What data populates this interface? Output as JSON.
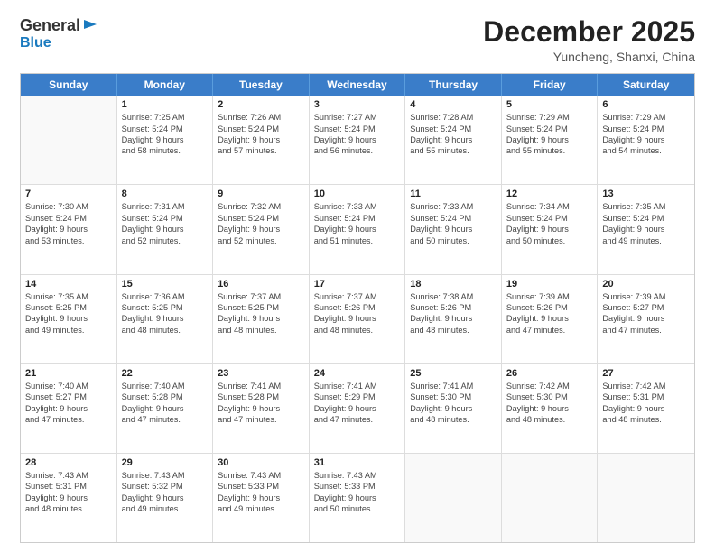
{
  "header": {
    "logo_general": "General",
    "logo_blue": "Blue",
    "month_title": "December 2025",
    "location": "Yuncheng, Shanxi, China"
  },
  "days_of_week": [
    "Sunday",
    "Monday",
    "Tuesday",
    "Wednesday",
    "Thursday",
    "Friday",
    "Saturday"
  ],
  "weeks": [
    [
      {
        "day": "",
        "empty": true,
        "lines": []
      },
      {
        "day": "1",
        "empty": false,
        "lines": [
          "Sunrise: 7:25 AM",
          "Sunset: 5:24 PM",
          "Daylight: 9 hours",
          "and 58 minutes."
        ]
      },
      {
        "day": "2",
        "empty": false,
        "lines": [
          "Sunrise: 7:26 AM",
          "Sunset: 5:24 PM",
          "Daylight: 9 hours",
          "and 57 minutes."
        ]
      },
      {
        "day": "3",
        "empty": false,
        "lines": [
          "Sunrise: 7:27 AM",
          "Sunset: 5:24 PM",
          "Daylight: 9 hours",
          "and 56 minutes."
        ]
      },
      {
        "day": "4",
        "empty": false,
        "lines": [
          "Sunrise: 7:28 AM",
          "Sunset: 5:24 PM",
          "Daylight: 9 hours",
          "and 55 minutes."
        ]
      },
      {
        "day": "5",
        "empty": false,
        "lines": [
          "Sunrise: 7:29 AM",
          "Sunset: 5:24 PM",
          "Daylight: 9 hours",
          "and 55 minutes."
        ]
      },
      {
        "day": "6",
        "empty": false,
        "lines": [
          "Sunrise: 7:29 AM",
          "Sunset: 5:24 PM",
          "Daylight: 9 hours",
          "and 54 minutes."
        ]
      }
    ],
    [
      {
        "day": "7",
        "empty": false,
        "lines": [
          "Sunrise: 7:30 AM",
          "Sunset: 5:24 PM",
          "Daylight: 9 hours",
          "and 53 minutes."
        ]
      },
      {
        "day": "8",
        "empty": false,
        "lines": [
          "Sunrise: 7:31 AM",
          "Sunset: 5:24 PM",
          "Daylight: 9 hours",
          "and 52 minutes."
        ]
      },
      {
        "day": "9",
        "empty": false,
        "lines": [
          "Sunrise: 7:32 AM",
          "Sunset: 5:24 PM",
          "Daylight: 9 hours",
          "and 52 minutes."
        ]
      },
      {
        "day": "10",
        "empty": false,
        "lines": [
          "Sunrise: 7:33 AM",
          "Sunset: 5:24 PM",
          "Daylight: 9 hours",
          "and 51 minutes."
        ]
      },
      {
        "day": "11",
        "empty": false,
        "lines": [
          "Sunrise: 7:33 AM",
          "Sunset: 5:24 PM",
          "Daylight: 9 hours",
          "and 50 minutes."
        ]
      },
      {
        "day": "12",
        "empty": false,
        "lines": [
          "Sunrise: 7:34 AM",
          "Sunset: 5:24 PM",
          "Daylight: 9 hours",
          "and 50 minutes."
        ]
      },
      {
        "day": "13",
        "empty": false,
        "lines": [
          "Sunrise: 7:35 AM",
          "Sunset: 5:24 PM",
          "Daylight: 9 hours",
          "and 49 minutes."
        ]
      }
    ],
    [
      {
        "day": "14",
        "empty": false,
        "lines": [
          "Sunrise: 7:35 AM",
          "Sunset: 5:25 PM",
          "Daylight: 9 hours",
          "and 49 minutes."
        ]
      },
      {
        "day": "15",
        "empty": false,
        "lines": [
          "Sunrise: 7:36 AM",
          "Sunset: 5:25 PM",
          "Daylight: 9 hours",
          "and 48 minutes."
        ]
      },
      {
        "day": "16",
        "empty": false,
        "lines": [
          "Sunrise: 7:37 AM",
          "Sunset: 5:25 PM",
          "Daylight: 9 hours",
          "and 48 minutes."
        ]
      },
      {
        "day": "17",
        "empty": false,
        "lines": [
          "Sunrise: 7:37 AM",
          "Sunset: 5:26 PM",
          "Daylight: 9 hours",
          "and 48 minutes."
        ]
      },
      {
        "day": "18",
        "empty": false,
        "lines": [
          "Sunrise: 7:38 AM",
          "Sunset: 5:26 PM",
          "Daylight: 9 hours",
          "and 48 minutes."
        ]
      },
      {
        "day": "19",
        "empty": false,
        "lines": [
          "Sunrise: 7:39 AM",
          "Sunset: 5:26 PM",
          "Daylight: 9 hours",
          "and 47 minutes."
        ]
      },
      {
        "day": "20",
        "empty": false,
        "lines": [
          "Sunrise: 7:39 AM",
          "Sunset: 5:27 PM",
          "Daylight: 9 hours",
          "and 47 minutes."
        ]
      }
    ],
    [
      {
        "day": "21",
        "empty": false,
        "lines": [
          "Sunrise: 7:40 AM",
          "Sunset: 5:27 PM",
          "Daylight: 9 hours",
          "and 47 minutes."
        ]
      },
      {
        "day": "22",
        "empty": false,
        "lines": [
          "Sunrise: 7:40 AM",
          "Sunset: 5:28 PM",
          "Daylight: 9 hours",
          "and 47 minutes."
        ]
      },
      {
        "day": "23",
        "empty": false,
        "lines": [
          "Sunrise: 7:41 AM",
          "Sunset: 5:28 PM",
          "Daylight: 9 hours",
          "and 47 minutes."
        ]
      },
      {
        "day": "24",
        "empty": false,
        "lines": [
          "Sunrise: 7:41 AM",
          "Sunset: 5:29 PM",
          "Daylight: 9 hours",
          "and 47 minutes."
        ]
      },
      {
        "day": "25",
        "empty": false,
        "lines": [
          "Sunrise: 7:41 AM",
          "Sunset: 5:30 PM",
          "Daylight: 9 hours",
          "and 48 minutes."
        ]
      },
      {
        "day": "26",
        "empty": false,
        "lines": [
          "Sunrise: 7:42 AM",
          "Sunset: 5:30 PM",
          "Daylight: 9 hours",
          "and 48 minutes."
        ]
      },
      {
        "day": "27",
        "empty": false,
        "lines": [
          "Sunrise: 7:42 AM",
          "Sunset: 5:31 PM",
          "Daylight: 9 hours",
          "and 48 minutes."
        ]
      }
    ],
    [
      {
        "day": "28",
        "empty": false,
        "lines": [
          "Sunrise: 7:43 AM",
          "Sunset: 5:31 PM",
          "Daylight: 9 hours",
          "and 48 minutes."
        ]
      },
      {
        "day": "29",
        "empty": false,
        "lines": [
          "Sunrise: 7:43 AM",
          "Sunset: 5:32 PM",
          "Daylight: 9 hours",
          "and 49 minutes."
        ]
      },
      {
        "day": "30",
        "empty": false,
        "lines": [
          "Sunrise: 7:43 AM",
          "Sunset: 5:33 PM",
          "Daylight: 9 hours",
          "and 49 minutes."
        ]
      },
      {
        "day": "31",
        "empty": false,
        "lines": [
          "Sunrise: 7:43 AM",
          "Sunset: 5:33 PM",
          "Daylight: 9 hours",
          "and 50 minutes."
        ]
      },
      {
        "day": "",
        "empty": true,
        "lines": []
      },
      {
        "day": "",
        "empty": true,
        "lines": []
      },
      {
        "day": "",
        "empty": true,
        "lines": []
      }
    ]
  ]
}
